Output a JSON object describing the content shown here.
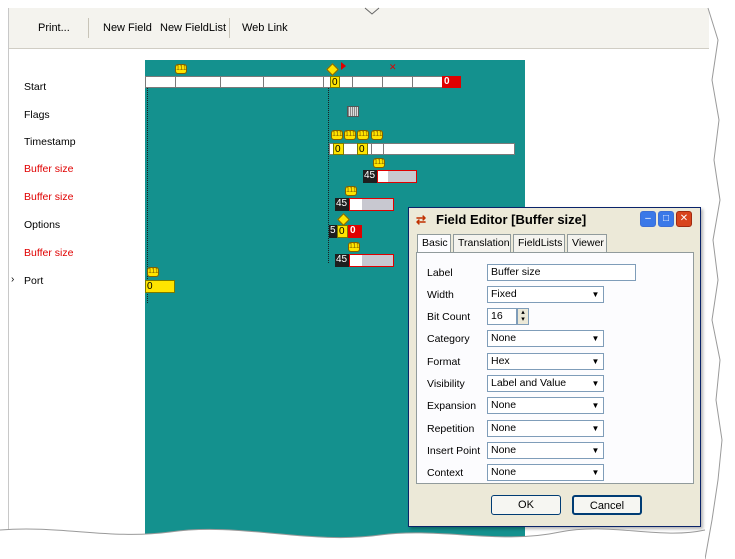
{
  "toolbar": {
    "print": "Print...",
    "new_field": "New Field",
    "new_fieldlist": "New FieldList",
    "web_link": "Web Link"
  },
  "fields": [
    {
      "label": "Start",
      "red": false
    },
    {
      "label": "Flags",
      "red": false
    },
    {
      "label": "Timestamp",
      "red": false
    },
    {
      "label": "Buffer size",
      "red": true
    },
    {
      "label": "Buffer size",
      "red": true
    },
    {
      "label": "Options",
      "red": false
    },
    {
      "label": "Buffer size",
      "red": true
    },
    {
      "label": "Port",
      "red": false
    }
  ],
  "port_marker": "›",
  "canvas": {
    "start_value": "0",
    "start_red_value": "0",
    "timestamp_value1": "0",
    "timestamp_value2": "0",
    "bs1_value": "45",
    "bs2_value": "45",
    "options_v1": "5",
    "options_v2": "0",
    "options_v3": "0",
    "bs3_value": "45",
    "port_value": "0",
    "badge_text": "111"
  },
  "dialog": {
    "title": "Field Editor [Buffer size]",
    "tabs": [
      "Basic",
      "Translation",
      "FieldLists",
      "Viewer"
    ],
    "label_caption": "Label",
    "label_value": "Buffer size",
    "width_caption": "Width",
    "width_value": "Fixed",
    "bitcount_caption": "Bit Count",
    "bitcount_value": "16",
    "category_caption": "Category",
    "category_value": "None",
    "format_caption": "Format",
    "format_value": "Hex",
    "visibility_caption": "Visibility",
    "visibility_value": "Label and Value",
    "expansion_caption": "Expansion",
    "expansion_value": "None",
    "repetition_caption": "Repetition",
    "repetition_value": "None",
    "insert_caption": "Insert Point",
    "insert_value": "None",
    "context_caption": "Context",
    "context_value": "None",
    "ok": "OK",
    "cancel": "Cancel"
  },
  "colors": {
    "canvas": "#14918e",
    "red_label": "#e00000",
    "highlight": "#ffe400"
  }
}
